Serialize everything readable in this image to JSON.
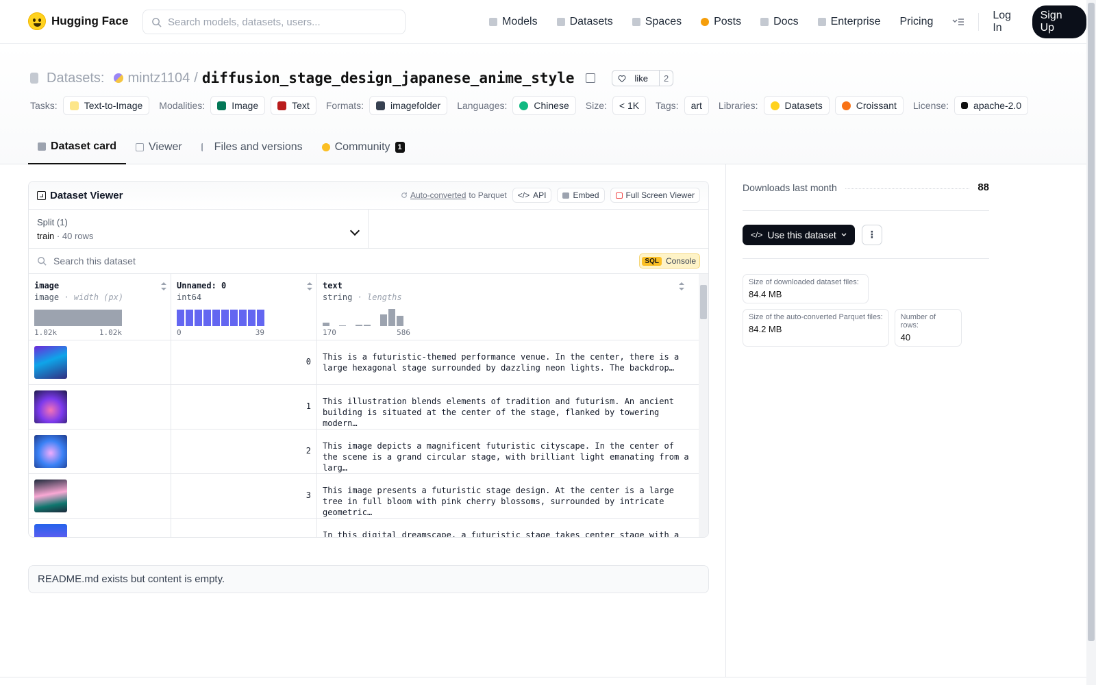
{
  "nav": {
    "brand": "Hugging Face",
    "search_placeholder": "Search models, datasets, users...",
    "items": [
      "Models",
      "Datasets",
      "Spaces",
      "Posts",
      "Docs",
      "Enterprise",
      "Pricing"
    ],
    "login": "Log In",
    "signup": "Sign Up"
  },
  "header": {
    "section": "Datasets:",
    "owner": "mintz1104",
    "slash": "/",
    "repo": "diffusion_stage_design_japanese_anime_style",
    "like_label": "like",
    "like_count": "2",
    "tags": {
      "tasks_label": "Tasks:",
      "task": "Text-to-Image",
      "modalities_label": "Modalities:",
      "modality1": "Image",
      "modality2": "Text",
      "formats_label": "Formats:",
      "format": "imagefolder",
      "languages_label": "Languages:",
      "language": "Chinese",
      "size_label": "Size:",
      "size": "< 1K",
      "tags_label": "Tags:",
      "tag": "art",
      "libraries_label": "Libraries:",
      "library1": "Datasets",
      "library2": "Croissant",
      "license_label": "License:",
      "license": "apache-2.0"
    },
    "tabs": {
      "card": "Dataset card",
      "viewer": "Viewer",
      "files": "Files and versions",
      "community": "Community",
      "community_count": "1"
    }
  },
  "viewer": {
    "title": "Dataset Viewer",
    "auto_converted": "Auto-converted",
    "to_parquet": "to Parquet",
    "api": "API",
    "embed": "Embed",
    "fullscreen": "Full Screen Viewer",
    "split_label": "Split (1)",
    "split_name": "train",
    "split_sep": "·",
    "split_rows": "40 rows",
    "search_placeholder": "Search this dataset",
    "sql": "SQL",
    "console": "Console",
    "columns": [
      {
        "name": "image",
        "type": "image",
        "note": "· width (px)",
        "min": "1.02k",
        "max": "1.02k"
      },
      {
        "name": "Unnamed: 0",
        "type": "int64",
        "note": "",
        "min": "0",
        "max": "39"
      },
      {
        "name": "text",
        "type": "string",
        "note": "· lengths",
        "min": "170",
        "max": "586"
      }
    ],
    "rows": [
      {
        "idx": "0",
        "text": "This is a futuristic-themed performance venue. In the center, there is a large hexagonal stage surrounded by dazzling neon lights. The backdrop…"
      },
      {
        "idx": "1",
        "text": "This illustration blends elements of tradition and futurism. An ancient building is situated at the center of the stage, flanked by towering modern…"
      },
      {
        "idx": "2",
        "text": "This image depicts a magnificent futuristic cityscape. In the center of the scene is a grand circular stage, with brilliant light emanating from a larg…"
      },
      {
        "idx": "3",
        "text": "This image presents a futuristic stage design. At the center is a large tree in full bloom with pink cherry blossoms, surrounded by intricate geometric…"
      },
      {
        "idx": "",
        "text": "In this digital dreamscape, a futuristic stage takes center stage with a"
      }
    ]
  },
  "readme": "README.md exists but content is empty.",
  "side": {
    "downloads_label": "Downloads last month",
    "downloads": "88",
    "use_button": "Use this dataset",
    "size_dl_label": "Size of downloaded dataset files:",
    "size_dl": "84.4 MB",
    "size_pq_label": "Size of the auto-converted Parquet files:",
    "size_pq": "84.2 MB",
    "rows_label": "Number of rows:",
    "rows": "40"
  },
  "colors": {
    "accent_dark": "#0b0f19",
    "hist_blue": "#6366f1",
    "hist_gray": "#9ca3af",
    "logo_yellow": "#FFD21E"
  }
}
